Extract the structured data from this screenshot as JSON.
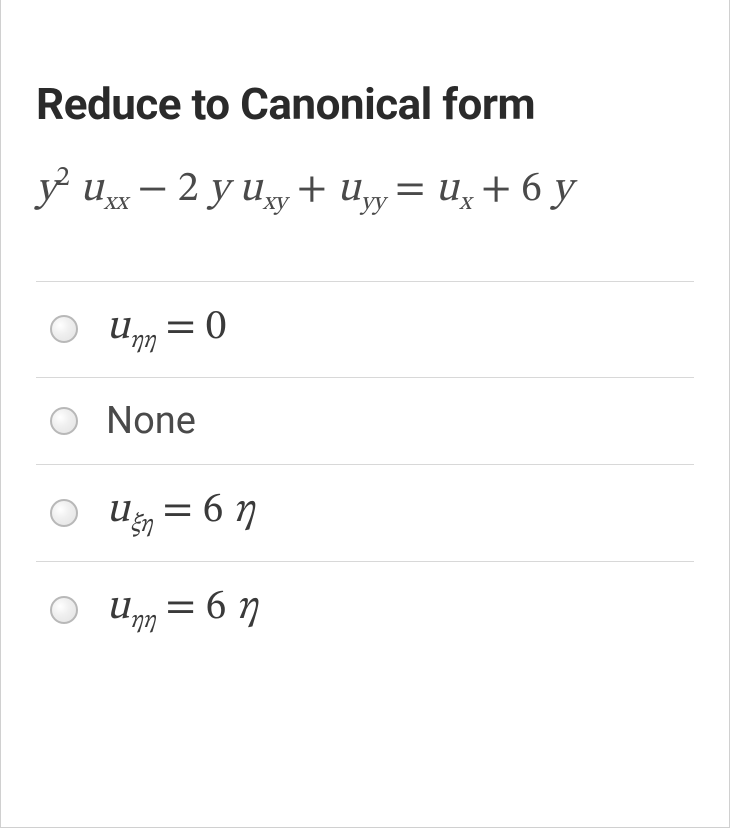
{
  "question": {
    "title": "Reduce to Canonical form",
    "equation_html": "<span>y</span><span class=\"sup upright\">2</span> <span>u</span><span class=\"sub\">xx</span> <span class=\"upright\">−</span> <span class=\"upright\">2</span> <span>y</span> <span>u</span><span class=\"sub\">xy</span> <span class=\"upright\">+</span> <span>u</span><span class=\"sub\">yy</span> <span class=\"upright\">=</span> <span>u</span><span class=\"sub\">x</span> <span class=\"upright\">+</span> <span class=\"upright\">6</span> <span>y</span>"
  },
  "options": [
    {
      "id": "opt1",
      "type": "math",
      "html": "<span>u</span><span class=\"sub\">ηη</span> <span class=\"upright\">=</span> <span class=\"upright\">0</span>"
    },
    {
      "id": "opt2",
      "type": "plain",
      "text": "None"
    },
    {
      "id": "opt3",
      "type": "math",
      "html": "<span>u</span><span class=\"sub\">ξη</span> <span class=\"upright\">=</span> <span class=\"upright\">6</span> <span>η</span>"
    },
    {
      "id": "opt4",
      "type": "math",
      "html": "<span>u</span><span class=\"sub\">ηη</span> <span class=\"upright\">=</span> <span class=\"upright\">6</span> <span>η</span>"
    }
  ]
}
